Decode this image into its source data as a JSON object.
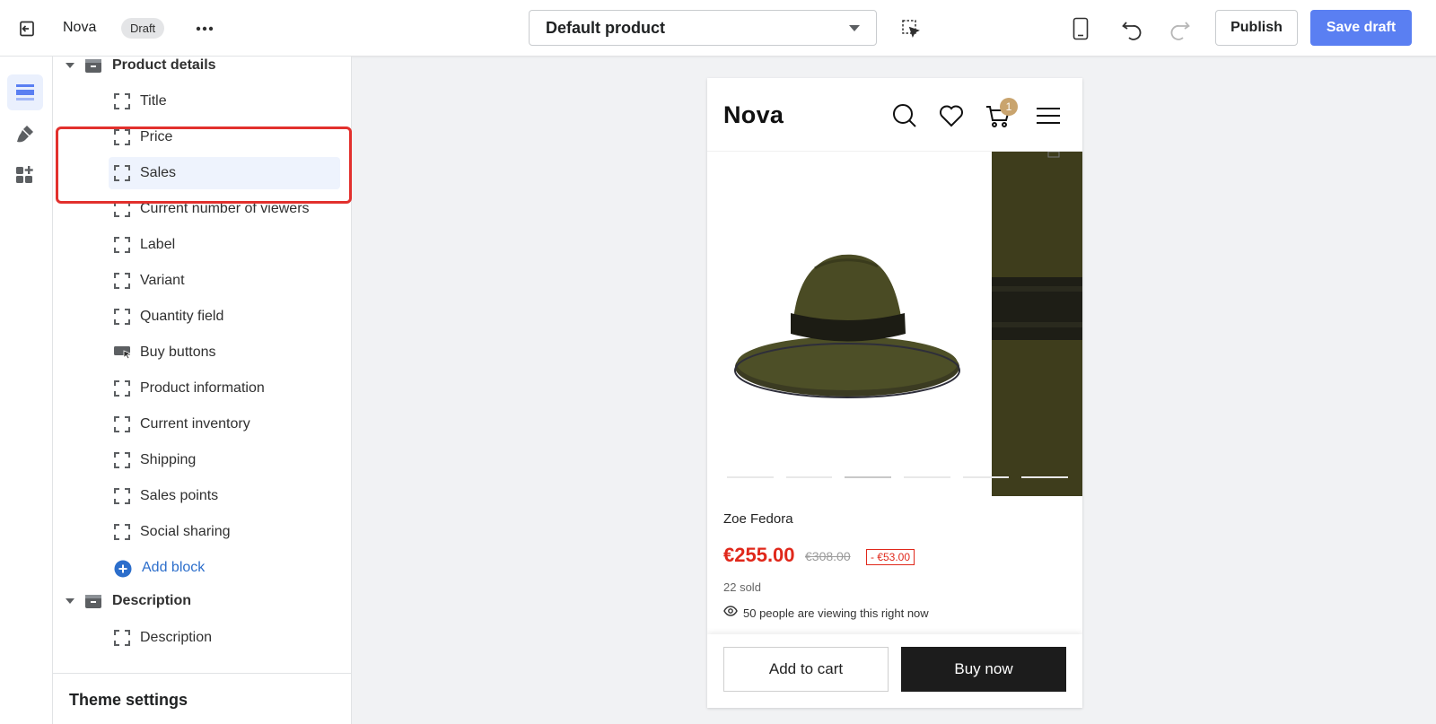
{
  "topbar": {
    "store_name": "Nova",
    "status_badge": "Draft",
    "template_select": "Default product",
    "publish_label": "Publish",
    "save_label": "Save draft"
  },
  "rail": {
    "items": [
      "sections",
      "theme-settings",
      "apps"
    ],
    "active_color": "#5a7ff2"
  },
  "sidebar": {
    "product_section": "Product details",
    "blocks": [
      "Title",
      "Price",
      "Sales",
      "Current number of viewers",
      "Label",
      "Variant",
      "Quantity field",
      "Buy buttons",
      "Product information",
      "Current inventory",
      "Shipping",
      "Sales points",
      "Social sharing"
    ],
    "selected_block": "Sales",
    "add_block": "Add block",
    "description_section": "Description",
    "description_block": "Description",
    "theme_settings": "Theme settings"
  },
  "preview": {
    "logo": "Nova",
    "cart_count": "1",
    "product_title": "Zoe Fedora",
    "price": "€255.00",
    "compare_price": "€308.00",
    "discount": "- €53.00",
    "sold": "22 sold",
    "viewers": "50 people are viewing this right now",
    "add_to_cart": "Add to cart",
    "buy_now": "Buy now",
    "gallery_slides": 6,
    "active_slide": 3
  },
  "colors": {
    "accent": "#5a7ff2",
    "highlight_border": "#e2302d",
    "sale_price": "#e0281b",
    "cart_badge": "#c9a46e"
  }
}
